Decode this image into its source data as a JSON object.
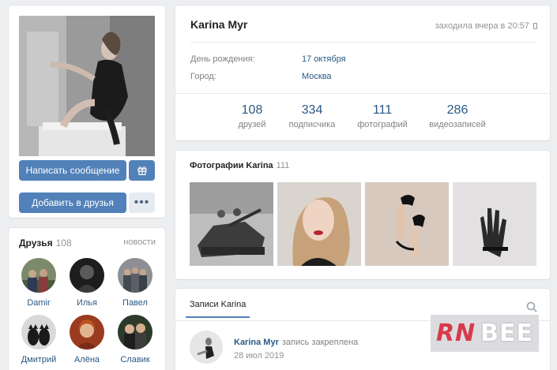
{
  "profile": {
    "name": "Karina Myr",
    "online_status": "заходила вчера в 20:57",
    "fields": [
      {
        "label": "День рождения:",
        "value": "17 октября"
      },
      {
        "label": "Город:",
        "value": "Москва"
      }
    ],
    "counters": [
      {
        "count": "108",
        "label": "друзей"
      },
      {
        "count": "334",
        "label": "подписчика"
      },
      {
        "count": "111",
        "label": "фотографий"
      },
      {
        "count": "286",
        "label": "видеозаписей"
      }
    ]
  },
  "actions": {
    "message_label": "Написать сообщение",
    "add_friend_label": "Добавить в друзья",
    "more_label": "•••",
    "gift_icon": "gift-icon"
  },
  "friends": {
    "title": "Друзья",
    "count": "108",
    "news_link": "новости",
    "people": [
      {
        "name": "Damir"
      },
      {
        "name": "Илья"
      },
      {
        "name": "Павел"
      },
      {
        "name": "Дмитрий"
      },
      {
        "name": "Алёна"
      },
      {
        "name": "Славик"
      }
    ]
  },
  "photos": {
    "title": "Фотографии Karina",
    "count": "111"
  },
  "posts": {
    "tab_label": "Записи Karina",
    "search_icon": "search-icon",
    "pinned": {
      "author": "Karina Myr",
      "note": "запись закреплена",
      "date": "28 июл 2019"
    }
  },
  "watermark": {
    "part1": "RN",
    "part2": "BEE"
  },
  "colors": {
    "accent": "#5181b8",
    "link": "#2a5885",
    "background": "#edeef0"
  }
}
